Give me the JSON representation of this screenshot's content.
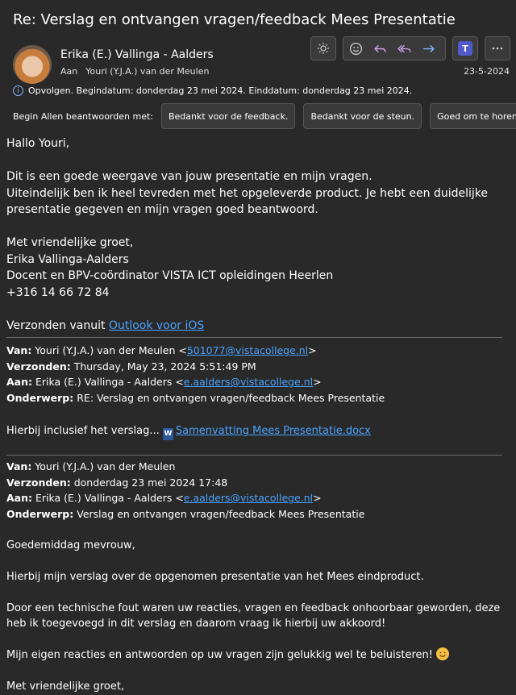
{
  "email": {
    "subject": "Re: Verslag en ontvangen vragen/feedback Mees Presentatie",
    "sender": "Erika (E.) Vallinga - Aalders",
    "to_label": "Aan",
    "to_value": "Youri (Y.J.A.) van der Meulen",
    "date": "23-5-2024",
    "followup": "Opvolgen.  Begindatum: donderdag 23 mei 2024.  Einddatum: donderdag 23 mei 2024."
  },
  "toolbar": {
    "icons": [
      "sun-icon",
      "emoji-icon",
      "reply-icon",
      "reply-all-icon",
      "forward-icon",
      "teams-icon",
      "more-icon"
    ]
  },
  "quick_reply": {
    "label": "Begin Allen beantwoorden met:",
    "options": [
      "Bedankt voor de feedback.",
      "Bedankt voor de steun.",
      "Goed om te horen. Be"
    ]
  },
  "body": {
    "greeting": "Hallo Youri,",
    "para1": "Dit is een goede weergave van jouw presentatie en mijn vragen.",
    "para2": "Uiteindelijk ben ik heel tevreden met het opgeleverde product. Je hebt een duidelijke presentatie gegeven en mijn vragen goed beantwoord.",
    "sig1": "Met vriendelijke groet,",
    "sig2": "Erika Vallinga-Aalders",
    "sig3": "Docent en BPV-coördinator VISTA ICT opleidingen Heerlen",
    "sig4": "+316 14 66 72 84",
    "sent_from": "Verzonden vanuit ",
    "sent_from_link": "Outlook voor iOS"
  },
  "quote1": {
    "from_label": "Van:",
    "from_value": " Youri (Y.J.A.) van der Meulen <",
    "from_email": "501077@vistacollege.nl",
    "from_end": ">",
    "sent_label": "Verzonden:",
    "sent_value": " Thursday, May 23, 2024 5:51:49 PM",
    "to_label": "Aan:",
    "to_value": " Erika (E.) Vallinga - Aalders <",
    "to_email": "e.aalders@vistacollege.nl",
    "to_end": ">",
    "subject_label": "Onderwerp:",
    "subject_value": " RE: Verslag en ontvangen vragen/feedback Mees Presentatie",
    "body": "Hierbij inclusief het verslag... ",
    "attachment": "Samenvatting Mees Presentatie.docx"
  },
  "quote2": {
    "from_label": "Van:",
    "from_value": " Youri (Y.J.A.) van der Meulen",
    "sent_label": "Verzonden:",
    "sent_value": " donderdag 23 mei 2024 17:48",
    "to_label": "Aan:",
    "to_value": " Erika (E.) Vallinga - Aalders <",
    "to_email": "e.aalders@vistacollege.nl",
    "to_end": ">",
    "subject_label": "Onderwerp:",
    "subject_value": " Verslag en ontvangen vragen/feedback Mees Presentatie",
    "p1": "Goedemiddag mevrouw,",
    "p2": "Hierbij mijn verslag over de opgenomen presentatie van het Mees eindproduct.",
    "p3": "Door een technische fout waren uw reacties, vragen en feedback onhoorbaar geworden, deze heb ik toegevoegd in dit verslag en daarom vraag ik hierbij uw akkoord!",
    "p4": "Mijn eigen reacties en antwoorden op uw vragen zijn gelukkig wel te beluisteren! ",
    "p5": "Met vriendelijke groet,"
  }
}
